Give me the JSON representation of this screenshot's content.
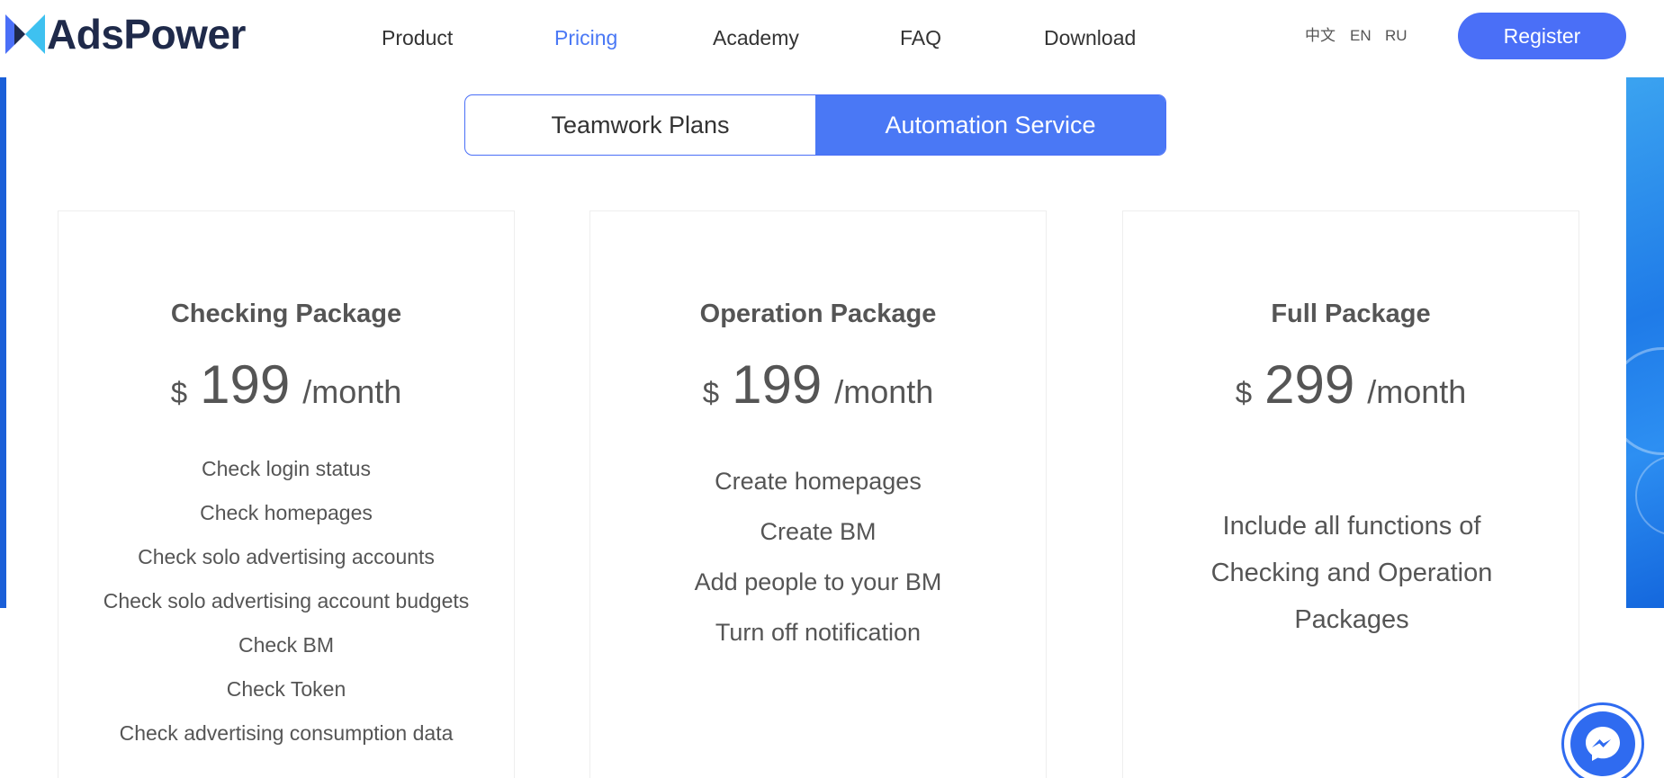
{
  "header": {
    "brand": "AdsPower",
    "nav": [
      {
        "label": "Product"
      },
      {
        "label": "Pricing"
      },
      {
        "label": "Academy"
      },
      {
        "label": "FAQ"
      },
      {
        "label": "Download"
      }
    ],
    "active_nav": "Pricing",
    "languages": [
      "中文",
      "EN",
      "RU"
    ],
    "register_label": "Register"
  },
  "toggle": {
    "options": [
      "Teamwork Plans",
      "Automation Service"
    ],
    "active": "Automation Service"
  },
  "cards": [
    {
      "title": "Checking Package",
      "currency": "$",
      "amount": "199",
      "period": "/month",
      "features": [
        "Check login status",
        "Check homepages",
        "Check solo advertising accounts",
        "Check solo advertising account budgets",
        "Check BM",
        "Check Token",
        "Check advertising consumption data"
      ]
    },
    {
      "title": "Operation Package",
      "currency": "$",
      "amount": "199",
      "period": "/month",
      "features": [
        "Create homepages",
        "Create BM",
        "Add people to your BM",
        "Turn off notification"
      ]
    },
    {
      "title": "Full Package",
      "currency": "$",
      "amount": "299",
      "period": "/month",
      "description": "Include all functions of Checking and Operation Packages"
    }
  ],
  "colors": {
    "accent": "#4a78f5",
    "register": "#4a6ff7",
    "text": "#555555",
    "messenger": "#2f6bf0"
  },
  "icons": {
    "logo": "adspower-logo-icon",
    "chat": "messenger-icon"
  }
}
